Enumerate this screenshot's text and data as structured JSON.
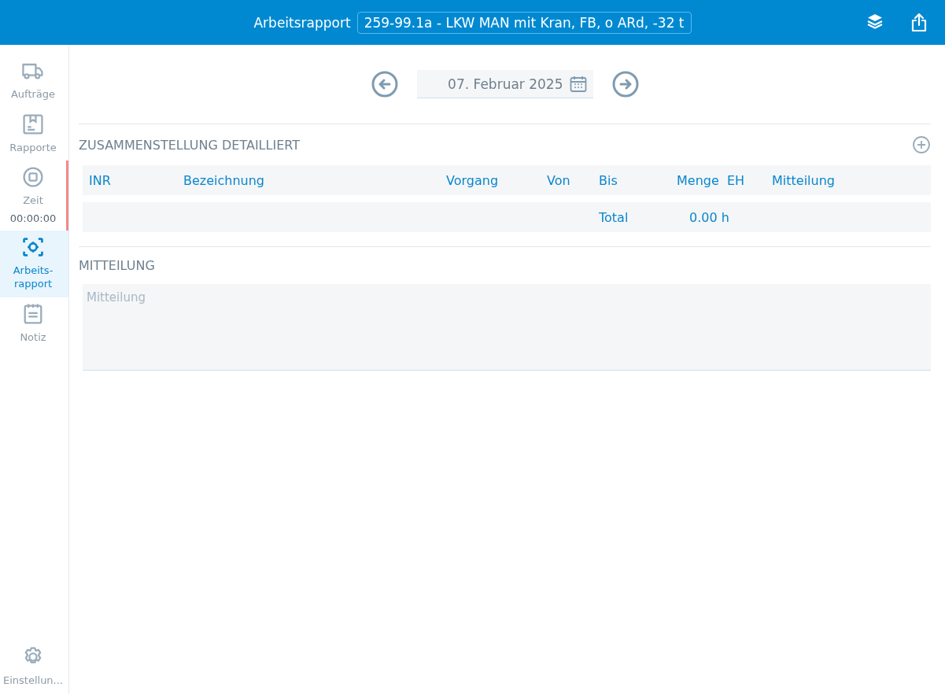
{
  "header": {
    "title": "Arbeitsrapport",
    "selector_value": "259-99.1a - LKW MAN mit Kran, FB, o ARd, -32 t"
  },
  "sidebar": {
    "items": [
      {
        "label": "Aufträge",
        "selected": false
      },
      {
        "label": "Rapporte",
        "selected": false
      },
      {
        "label": "Zeit",
        "selected": false,
        "timer": "00:00:00",
        "timer_active": true
      },
      {
        "label": "Arbeits-\nrapport",
        "selected": true
      },
      {
        "label": "Notiz",
        "selected": false
      }
    ],
    "settings": {
      "label": "Einstellun..."
    }
  },
  "date_nav": {
    "date": "07. Februar 2025"
  },
  "summary": {
    "title": "ZUSAMMENSTELLUNG DETAILLIERT",
    "columns": [
      "INR",
      "Bezeichnung",
      "Vorgang",
      "Von",
      "Bis",
      "Menge",
      "EH",
      "Mitteilung"
    ],
    "total_label": "Total",
    "total_value": "0.00 h"
  },
  "message": {
    "title": "MITTEILUNG",
    "placeholder": "Mitteilung"
  }
}
